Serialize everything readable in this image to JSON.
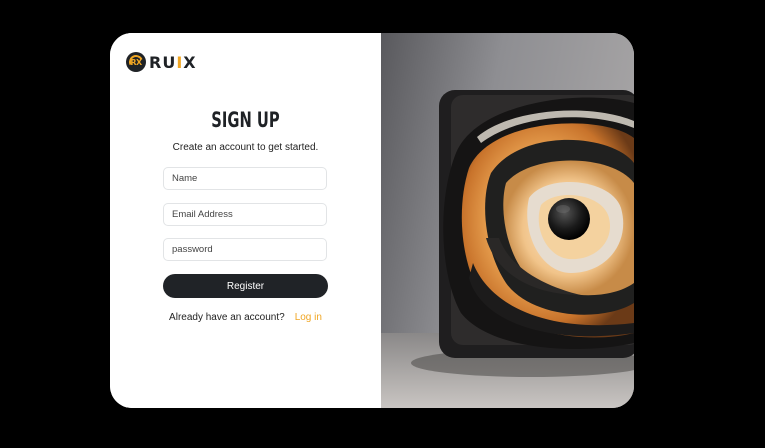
{
  "brand": {
    "mark_text": "RX",
    "name_part1": "RU",
    "name_accent": "I",
    "name_part2": "X",
    "accent_color": "#f0a623",
    "dark_color": "#1f2226"
  },
  "form": {
    "title": "SIGN UP",
    "subtitle": "Create an account to get started.",
    "name_placeholder": "Name",
    "email_placeholder": "Email Address",
    "password_placeholder": "password",
    "register_label": "Register"
  },
  "footer": {
    "prompt": "Already have an account?",
    "login_label": "Log in"
  },
  "artwork": {
    "icon": "abstract-swirl-sculpture-image"
  }
}
